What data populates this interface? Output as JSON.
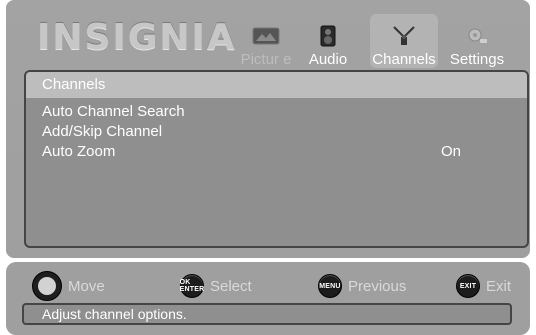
{
  "brand": {
    "logo_text": "INSIGNIA"
  },
  "tabs": [
    {
      "label": "Pictur e",
      "icon": "picture-icon",
      "state": "inactive"
    },
    {
      "label": "Audio",
      "icon": "speaker-icon",
      "state": "active"
    },
    {
      "label": "Channels",
      "icon": "antenna-icon",
      "state": "selected"
    },
    {
      "label": "Settings",
      "icon": "settings-icon",
      "state": "active"
    }
  ],
  "menu": {
    "title": "Channels",
    "items": [
      {
        "label": "Auto Channel Search",
        "value": ""
      },
      {
        "label": "Add/Skip Channel",
        "value": ""
      },
      {
        "label": "Auto Zoom",
        "value": "On"
      }
    ]
  },
  "help": {
    "move": {
      "label": "Move",
      "button": ""
    },
    "select": {
      "label": "Select",
      "button": "OK ENTER"
    },
    "previous": {
      "label": "Previous",
      "button": "MENU"
    },
    "exit": {
      "label": "Exit",
      "button": "EXIT"
    }
  },
  "status": {
    "text": "Adjust channel options."
  },
  "colors": {
    "panel": "#a3a3a3",
    "list_bg": "#8f8f8f",
    "header_bg": "#bdbdbd",
    "text": "#ffffff",
    "button": "#1c1c1c"
  }
}
